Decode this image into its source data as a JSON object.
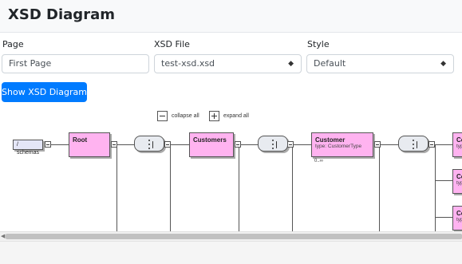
{
  "header": {
    "title": "XSD Diagram"
  },
  "form": {
    "page": {
      "label": "Page",
      "value": "First Page"
    },
    "xsd_file": {
      "label": "XSD File",
      "value": "test-xsd.xsd"
    },
    "style": {
      "label": "Style",
      "value": "Default"
    }
  },
  "show_button": "Show XSD Diagram",
  "controls": {
    "collapse": "collapse all",
    "expand": "expand all"
  },
  "diagram": {
    "schema_ref": "/ schemas",
    "nodes": [
      {
        "name": "Root"
      },
      {
        "name": "Customers"
      },
      {
        "name": "Customer",
        "type": "type: CustomerType",
        "occurs": "0..∞"
      }
    ],
    "partial_nodes": [
      {
        "name": "Co",
        "type": "typ"
      },
      {
        "name": "Co",
        "type": "typ"
      },
      {
        "name": "Co",
        "type": "typ"
      }
    ]
  },
  "icons": {
    "select_caret": "chevron-down-icon",
    "collapse": "minus-square-icon",
    "expand": "plus-square-icon",
    "sequence": "sequence-compositor-icon"
  }
}
